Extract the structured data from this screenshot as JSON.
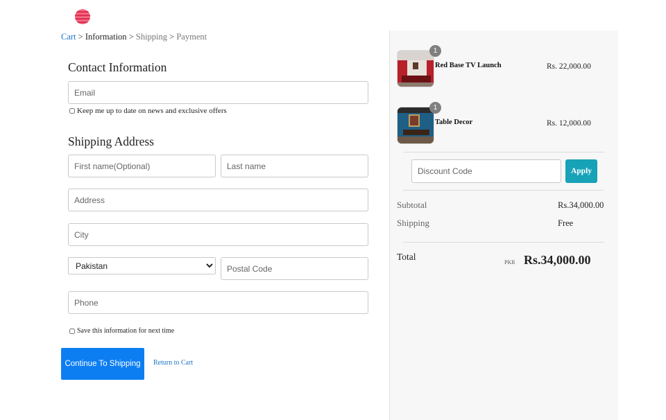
{
  "brand": {
    "logo_icon": "striped-globe-logo",
    "logo_colors": [
      "#f2506e",
      "#e83a5c"
    ]
  },
  "breadcrumb": {
    "cart": "Cart",
    "information": "Information",
    "shipping": "Shipping",
    "payment": "Payment",
    "separator": ">"
  },
  "contact": {
    "title": "Contact Information",
    "email_placeholder": "Email",
    "newsletter_label": "Keep me up to date on news and exclusive offers"
  },
  "shipping": {
    "title": "Shipping Address",
    "first_name_placeholder": "First name(Optional)",
    "last_name_placeholder": "Last name",
    "address_placeholder": "Address",
    "city_placeholder": "City",
    "country_selected": "Pakistan",
    "postal_placeholder": "Postal Code",
    "phone_placeholder": "Phone",
    "save_info_label": "Save this information for next time"
  },
  "actions": {
    "continue_label": "Continue To Shipping",
    "return_label": "Return to Cart",
    "primary_color": "#0d7ef2"
  },
  "order": {
    "items": [
      {
        "quantity": "1",
        "name": "Red Base TV Launch",
        "price": "Rs. 22,000.00"
      },
      {
        "quantity": "1",
        "name": "Table Decor",
        "price": "Rs. 12,000.00"
      }
    ],
    "discount_placeholder": "Discount Code",
    "apply_label": "Apply",
    "apply_color": "#17a2b8",
    "subtotal_label": "Subtotal",
    "subtotal_value": "Rs.34,000.00",
    "shipping_label": "Shipping",
    "shipping_value": "Free",
    "total_label": "Total",
    "currency_code": "PKR",
    "total_value": "Rs.34,000.00"
  }
}
